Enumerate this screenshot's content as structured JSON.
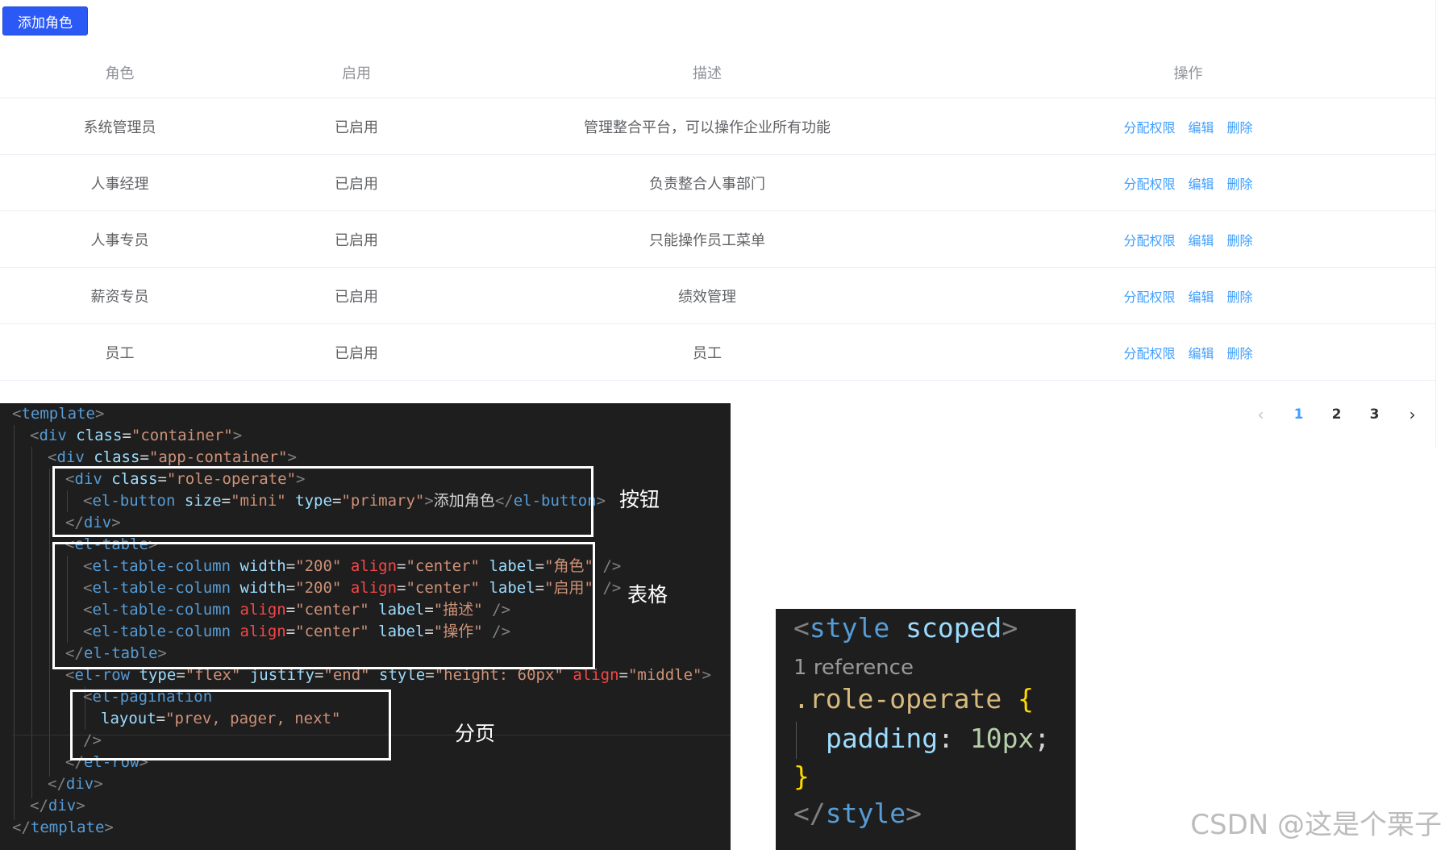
{
  "toolbar": {
    "add_role_label": "添加角色"
  },
  "table": {
    "headers": [
      "角色",
      "启用",
      "描述",
      "操作"
    ],
    "rows": [
      {
        "role": "系统管理员",
        "enabled": "已启用",
        "desc": "管理整合平台，可以操作企业所有功能"
      },
      {
        "role": "人事经理",
        "enabled": "已启用",
        "desc": "负责整合人事部门"
      },
      {
        "role": "人事专员",
        "enabled": "已启用",
        "desc": "只能操作员工菜单"
      },
      {
        "role": "薪资专员",
        "enabled": "已启用",
        "desc": "绩效管理"
      },
      {
        "role": "员工",
        "enabled": "已启用",
        "desc": "员工"
      }
    ],
    "actions": {
      "assign": "分配权限",
      "edit": "编辑",
      "delete": "删除"
    }
  },
  "pagination": {
    "prev_icon": "chevron-left-icon",
    "pages": [
      "1",
      "2",
      "3"
    ],
    "current": "1",
    "next_icon": "chevron-right-icon"
  },
  "code_panel": {
    "annotations": {
      "button": "按钮",
      "table": "表格",
      "pagination": "分页"
    }
  },
  "style_panel": {
    "reference": "1 reference"
  },
  "watermark": "CSDN @这是个栗子"
}
